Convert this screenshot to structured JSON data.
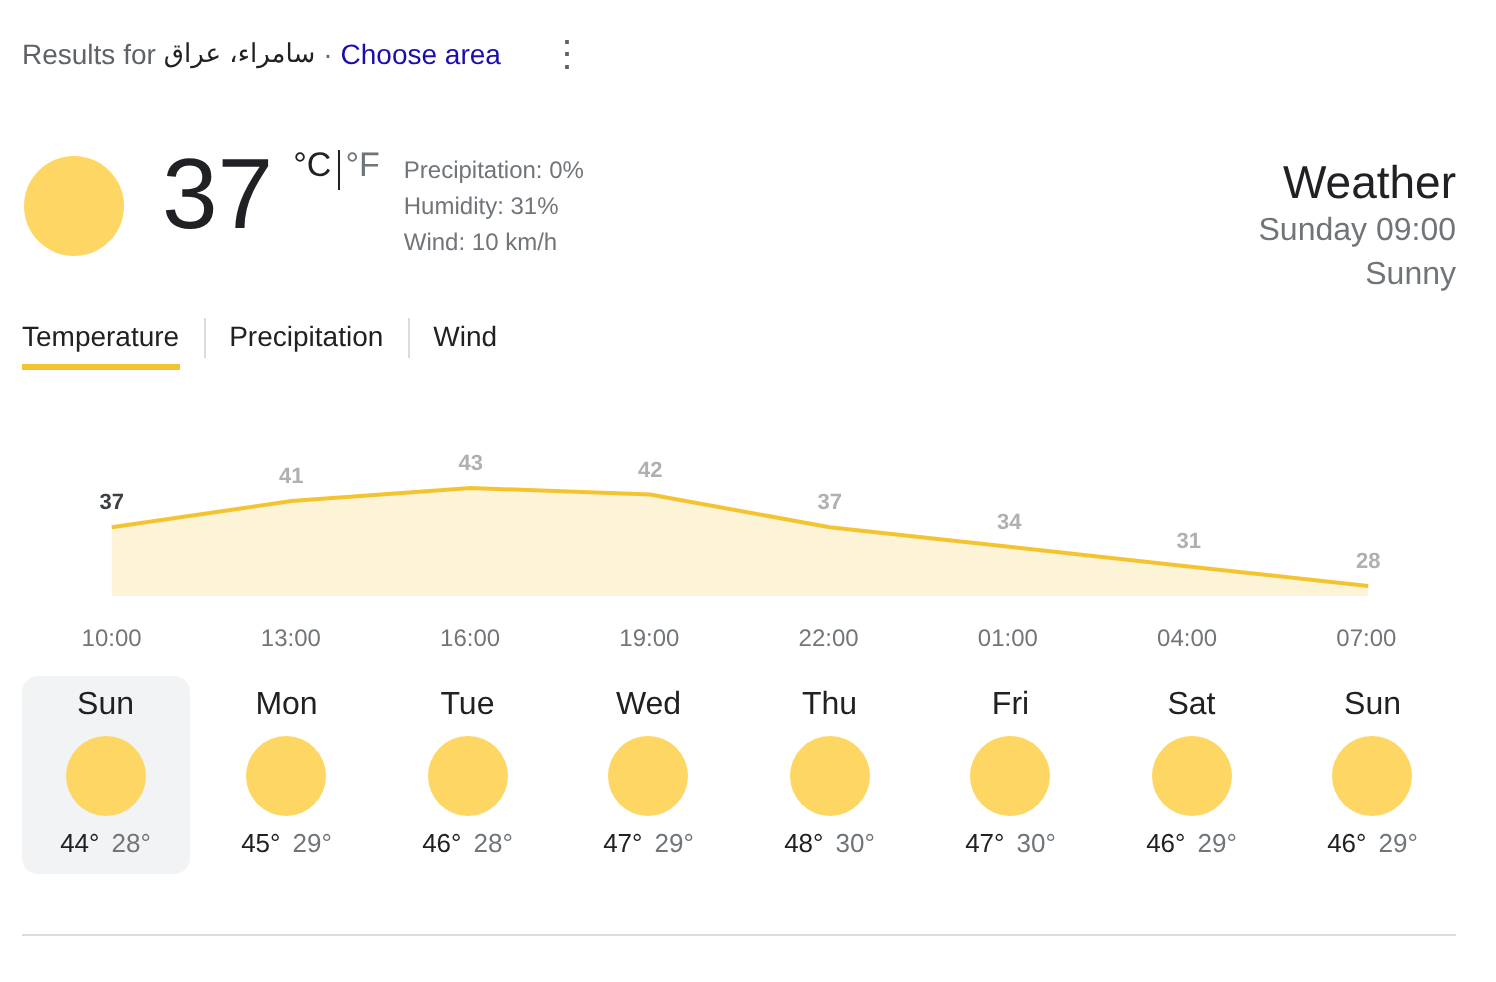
{
  "header": {
    "prefix": "Results for",
    "location": "سامراء، عراق",
    "separator": "·",
    "link": "Choose area",
    "menu": "⋮"
  },
  "current": {
    "temperature": "37",
    "units": [
      {
        "label": "°C",
        "selected": true
      },
      {
        "label": "°F",
        "selected": false
      }
    ],
    "details": [
      "Precipitation: 0%",
      "Humidity: 31%",
      "Wind: 10 km/h"
    ],
    "title": "Weather",
    "time": "Sunday 09:00",
    "condition": "Sunny"
  },
  "tabs": [
    {
      "label": "Temperature",
      "selected": true
    },
    {
      "label": "Precipitation",
      "selected": false
    },
    {
      "label": "Wind",
      "selected": false
    }
  ],
  "chart_data": {
    "type": "area",
    "categories": [
      "10:00",
      "13:00",
      "16:00",
      "19:00",
      "22:00",
      "01:00",
      "04:00",
      "07:00"
    ],
    "series": [
      {
        "color": "#f4c430",
        "values": [
          37,
          41,
          43,
          42,
          37,
          34,
          31,
          28
        ]
      }
    ],
    "data_labels": true
  },
  "days": [
    {
      "day": "Sun",
      "high": "44°",
      "low": "28°",
      "selected": true
    },
    {
      "day": "Mon",
      "high": "45°",
      "low": "29°",
      "selected": false
    },
    {
      "day": "Tue",
      "high": "46°",
      "low": "28°",
      "selected": false
    },
    {
      "day": "Wed",
      "high": "47°",
      "low": "29°",
      "selected": false
    },
    {
      "day": "Thu",
      "high": "48°",
      "low": "30°",
      "selected": false
    },
    {
      "day": "Fri",
      "high": "47°",
      "low": "30°",
      "selected": false
    },
    {
      "day": "Sat",
      "high": "46°",
      "low": "29°",
      "selected": false
    },
    {
      "day": "Sun",
      "high": "46°",
      "low": "29°",
      "selected": false
    }
  ]
}
